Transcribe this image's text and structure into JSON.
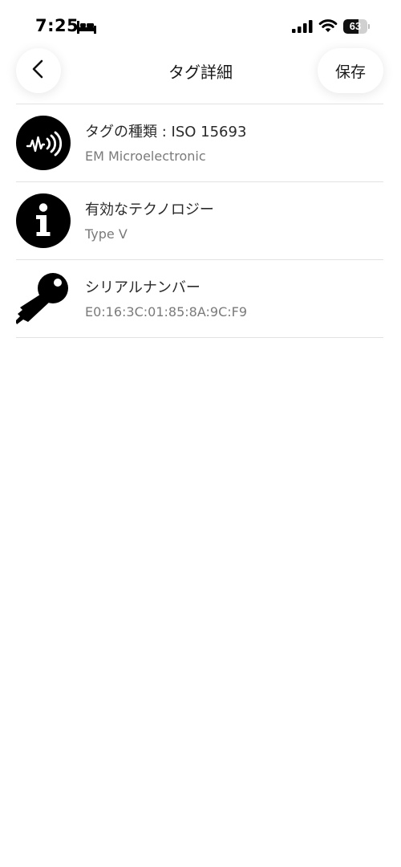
{
  "status_bar": {
    "time": "7:25",
    "battery_level": "63",
    "battery_fraction": 0.63,
    "icons": [
      "bed-icon",
      "cellular-signal-icon",
      "wifi-icon",
      "battery-icon"
    ]
  },
  "nav": {
    "title": "タグ詳細",
    "back_icon": "chevron-left-icon",
    "save_label": "保存"
  },
  "items": [
    {
      "icon": "nfc-sound-icon",
      "label": "タグの種類 : ISO 15693",
      "value": "EM Microelectronic"
    },
    {
      "icon": "info-icon",
      "label": "有効なテクノロジー",
      "value": "Type V"
    },
    {
      "icon": "key-icon",
      "label": "シリアルナンバー",
      "value": "E0:16:3C:01:85:8A:9C:F9"
    }
  ],
  "colors": {
    "icon_fill": "#000000",
    "divider": "#e2e2e2",
    "secondary_text": "#7a7a7a"
  }
}
